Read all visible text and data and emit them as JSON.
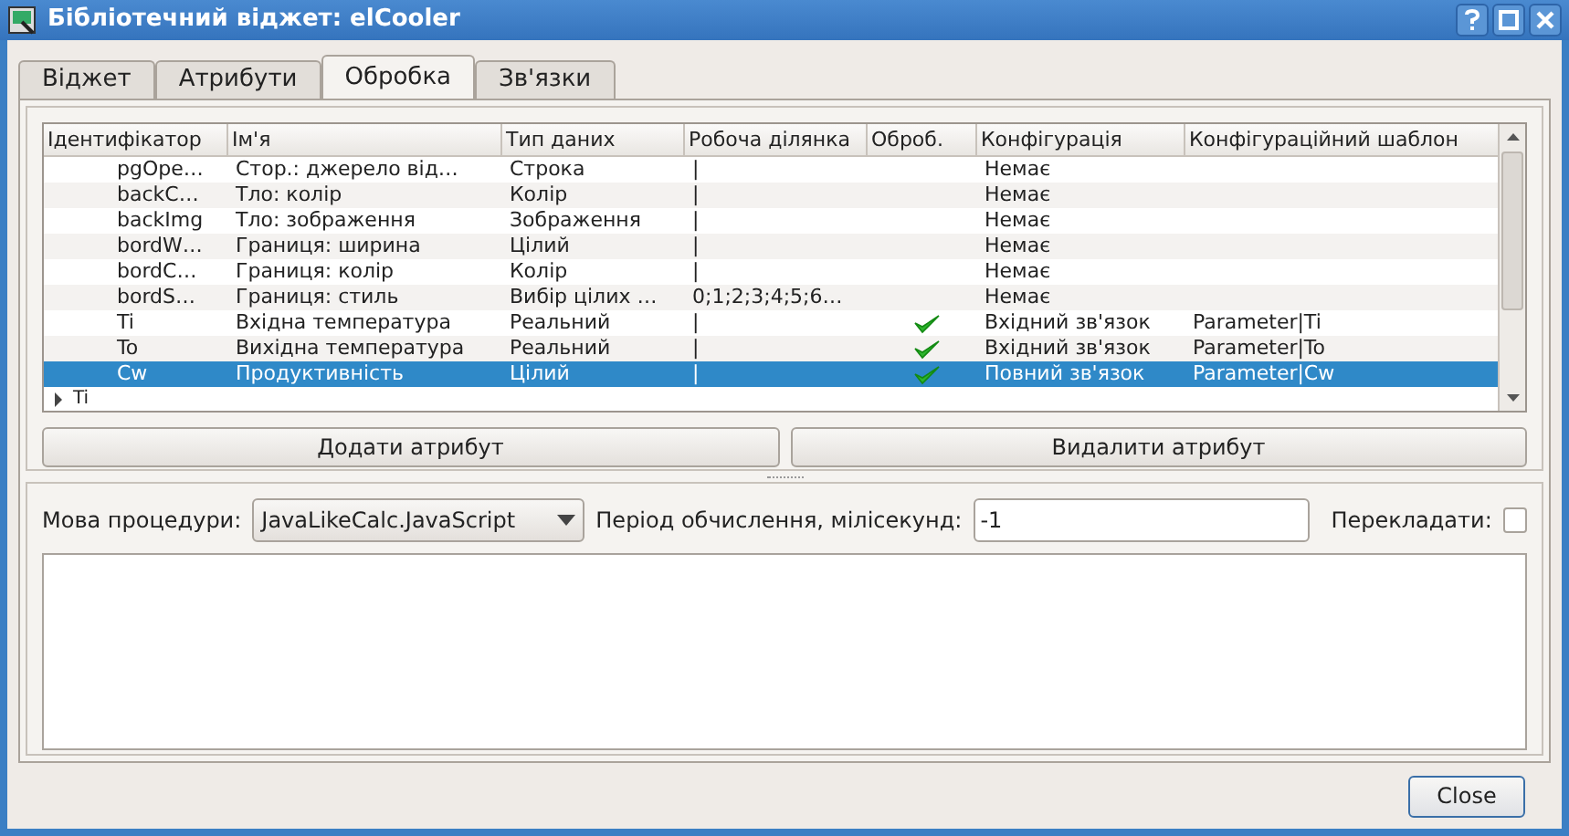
{
  "window": {
    "title": "Бібліотечний віджет: elCooler"
  },
  "tabs": [
    {
      "label": "Віджет",
      "selected": false
    },
    {
      "label": "Атрибути",
      "selected": false
    },
    {
      "label": "Обробка",
      "selected": true
    },
    {
      "label": "Зв'язки",
      "selected": false
    }
  ],
  "table": {
    "columns": [
      "Ідентифікатор",
      "Ім'я",
      "Тип даних",
      "Робоча ділянка",
      "Оброб.",
      "Конфігурація",
      "Конфігураційний шаблон"
    ],
    "rows": [
      {
        "id": "pgOpe…",
        "name": "Стор.: джерело від…",
        "type": "Строка",
        "work": "|",
        "processed": false,
        "config": "Немає",
        "template": "",
        "selected": false
      },
      {
        "id": "backC…",
        "name": "Тло: колір",
        "type": "Колір",
        "work": "|",
        "processed": false,
        "config": "Немає",
        "template": "",
        "selected": false
      },
      {
        "id": "backImg",
        "name": "Тло: зображення",
        "type": "Зображення",
        "work": "|",
        "processed": false,
        "config": "Немає",
        "template": "",
        "selected": false
      },
      {
        "id": "bordW…",
        "name": "Границя: ширина",
        "type": "Цілий",
        "work": "|",
        "processed": false,
        "config": "Немає",
        "template": "",
        "selected": false
      },
      {
        "id": "bordC…",
        "name": "Границя: колір",
        "type": "Колір",
        "work": "|",
        "processed": false,
        "config": "Немає",
        "template": "",
        "selected": false
      },
      {
        "id": "bordS…",
        "name": "Границя: стиль",
        "type": "Вибір цілих …",
        "work": "0;1;2;3;4;5;6…",
        "processed": false,
        "config": "Немає",
        "template": "",
        "selected": false
      },
      {
        "id": "Ti",
        "name": "Вхідна температура",
        "type": "Реальний",
        "work": "|",
        "processed": true,
        "config": "Вхідний зв'язок",
        "template": "Parameter|Ti",
        "selected": false
      },
      {
        "id": "To",
        "name": "Вихідна температура",
        "type": "Реальний",
        "work": "|",
        "processed": true,
        "config": "Вхідний зв'язок",
        "template": "Parameter|To",
        "selected": false
      },
      {
        "id": "Cw",
        "name": "Продуктивність",
        "type": "Цілий",
        "work": "|",
        "processed": true,
        "config": "Повний зв'язок",
        "template": "Parameter|Cw",
        "selected": true
      }
    ],
    "tree_items": [
      {
        "label": "Ti",
        "expanded": false
      }
    ]
  },
  "buttons": [
    "Додати атрибут",
    "Видалити атрибут"
  ],
  "procedure": {
    "language_label": "Мова процедури:",
    "language": "JavaLikeCalc.JavaScript",
    "period_label": "Період обчислення, мілісекунд:",
    "period": "-1",
    "translate_label": "Перекладати:",
    "translate": false
  },
  "close_button": "Close"
}
